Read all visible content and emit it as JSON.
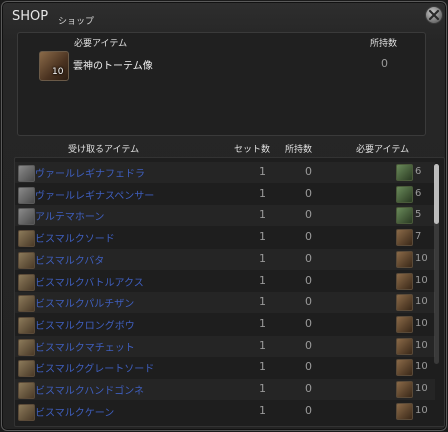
{
  "window": {
    "title": "SHOP",
    "subtitle": "ショップ"
  },
  "required_panel": {
    "header_required": "必要アイテム",
    "header_owned": "所持数",
    "item_name": "雲神のトーテム像",
    "item_quantity": "10",
    "owned": "0"
  },
  "list_headers": {
    "received_item": "受け取るアイテム",
    "set_count": "セット数",
    "owned": "所持数",
    "required_item": "必要アイテム"
  },
  "items": [
    {
      "name": "ヴァールレギナフェドラ",
      "set": "1",
      "owned": "0",
      "req": "6",
      "icon": "helm-icon",
      "req_icon": "green-item-icon"
    },
    {
      "name": "ヴァールレギナスペンサー",
      "set": "1",
      "owned": "0",
      "req": "6",
      "icon": "helm-icon",
      "req_icon": "green-item-icon"
    },
    {
      "name": "アルテマホーン",
      "set": "1",
      "owned": "0",
      "req": "5",
      "icon": "horn-icon",
      "req_icon": "green-item-icon"
    },
    {
      "name": "ビスマルクソード",
      "set": "1",
      "owned": "0",
      "req": "7",
      "icon": "sword-icon",
      "req_icon": "totem-item-icon"
    },
    {
      "name": "ビスマルクバタ",
      "set": "1",
      "owned": "0",
      "req": "10",
      "icon": "weapon-icon",
      "req_icon": "totem-item-icon"
    },
    {
      "name": "ビスマルクバトルアクス",
      "set": "1",
      "owned": "0",
      "req": "10",
      "icon": "axe-icon",
      "req_icon": "totem-item-icon"
    },
    {
      "name": "ビスマルクパルチザン",
      "set": "1",
      "owned": "0",
      "req": "10",
      "icon": "spear-icon",
      "req_icon": "totem-item-icon"
    },
    {
      "name": "ビスマルクロングボウ",
      "set": "1",
      "owned": "0",
      "req": "10",
      "icon": "bow-icon",
      "req_icon": "totem-item-icon"
    },
    {
      "name": "ビスマルクマチェット",
      "set": "1",
      "owned": "0",
      "req": "10",
      "icon": "blade-icon",
      "req_icon": "totem-item-icon"
    },
    {
      "name": "ビスマルクグレートソード",
      "set": "1",
      "owned": "0",
      "req": "10",
      "icon": "greatsword-icon",
      "req_icon": "totem-item-icon"
    },
    {
      "name": "ビスマルクハンドゴンネ",
      "set": "1",
      "owned": "0",
      "req": "10",
      "icon": "gun-icon",
      "req_icon": "totem-item-icon"
    },
    {
      "name": "ビスマルクケーン",
      "set": "1",
      "owned": "0",
      "req": "10",
      "icon": "cane-icon",
      "req_icon": "totem-item-icon"
    }
  ]
}
